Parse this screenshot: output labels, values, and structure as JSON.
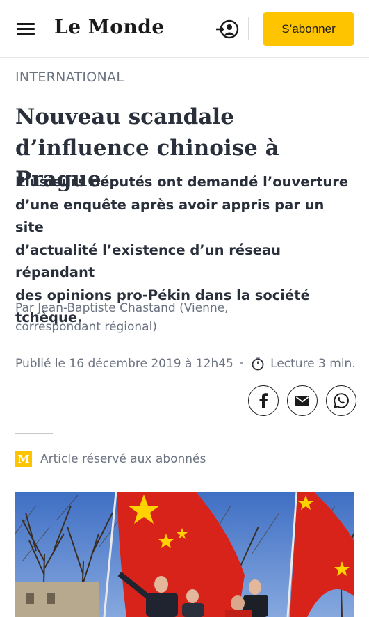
{
  "header": {
    "logo_text": "Le Monde",
    "subscribe_label": "S’abonner",
    "icons": [
      "menu-icon",
      "account-login-icon"
    ]
  },
  "article": {
    "section": "INTERNATIONAL",
    "headline_line1": "Nouveau scandale",
    "headline_line2": "d’influence chinoise à Prague",
    "lede_lines": [
      "Plusieurs députés ont demandé l’ouverture",
      "d’une enquête après avoir appris par un site",
      "d’actualité l’existence d’un réseau répandant",
      "des opinions pro-Pékin dans la société",
      "tchèque."
    ],
    "byline_line1": "Par Jean-Baptiste Chastand (Vienne,",
    "byline_line2": "correspondant régional)",
    "published": "Publié le 16 décembre 2019 à 12h45",
    "separator": "•",
    "reading_time": "Lecture 3 min.",
    "premium_label": "Article réservé aux abonnés",
    "premium_badge": "M"
  },
  "share": {
    "icons": [
      "facebook-icon",
      "email-icon",
      "whatsapp-icon"
    ]
  },
  "colors": {
    "accent": "#ffc400",
    "text": "#2a303b",
    "muted": "#6b7280",
    "flag_red": "#d8231a",
    "flag_star": "#ffd200"
  }
}
